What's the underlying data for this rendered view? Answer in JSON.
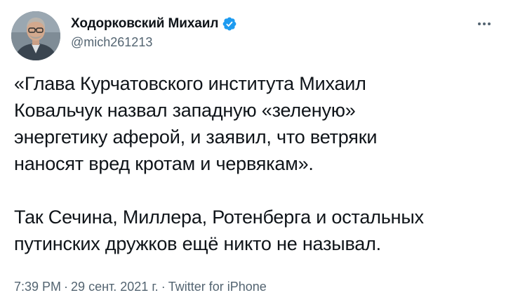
{
  "author": {
    "display_name": "Ходорковский Михаил",
    "handle": "@mich261213",
    "verified_icon": "verified-badge-icon",
    "avatar_icon": "avatar-photo"
  },
  "more_menu_icon": "more-options-icon",
  "tweet": {
    "paragraph_1": "«Глава Курчатовского института Михаил\nКовальчук назвал западную «зеленую»\nэнергетику аферой, и заявил, что ветряки\nнаносят вред кротам и червякам».",
    "paragraph_2": "Так Сечина, Миллера, Ротенберга и остальных\nпутинских дружков ещё никто не называл."
  },
  "meta": {
    "time": "7:39 PM",
    "separator": "·",
    "date": "29 сент. 2021 г.",
    "source": "Twitter for iPhone"
  },
  "colors": {
    "accent": "#1d9bf0",
    "text": "#0f1419",
    "secondary": "#536471"
  }
}
